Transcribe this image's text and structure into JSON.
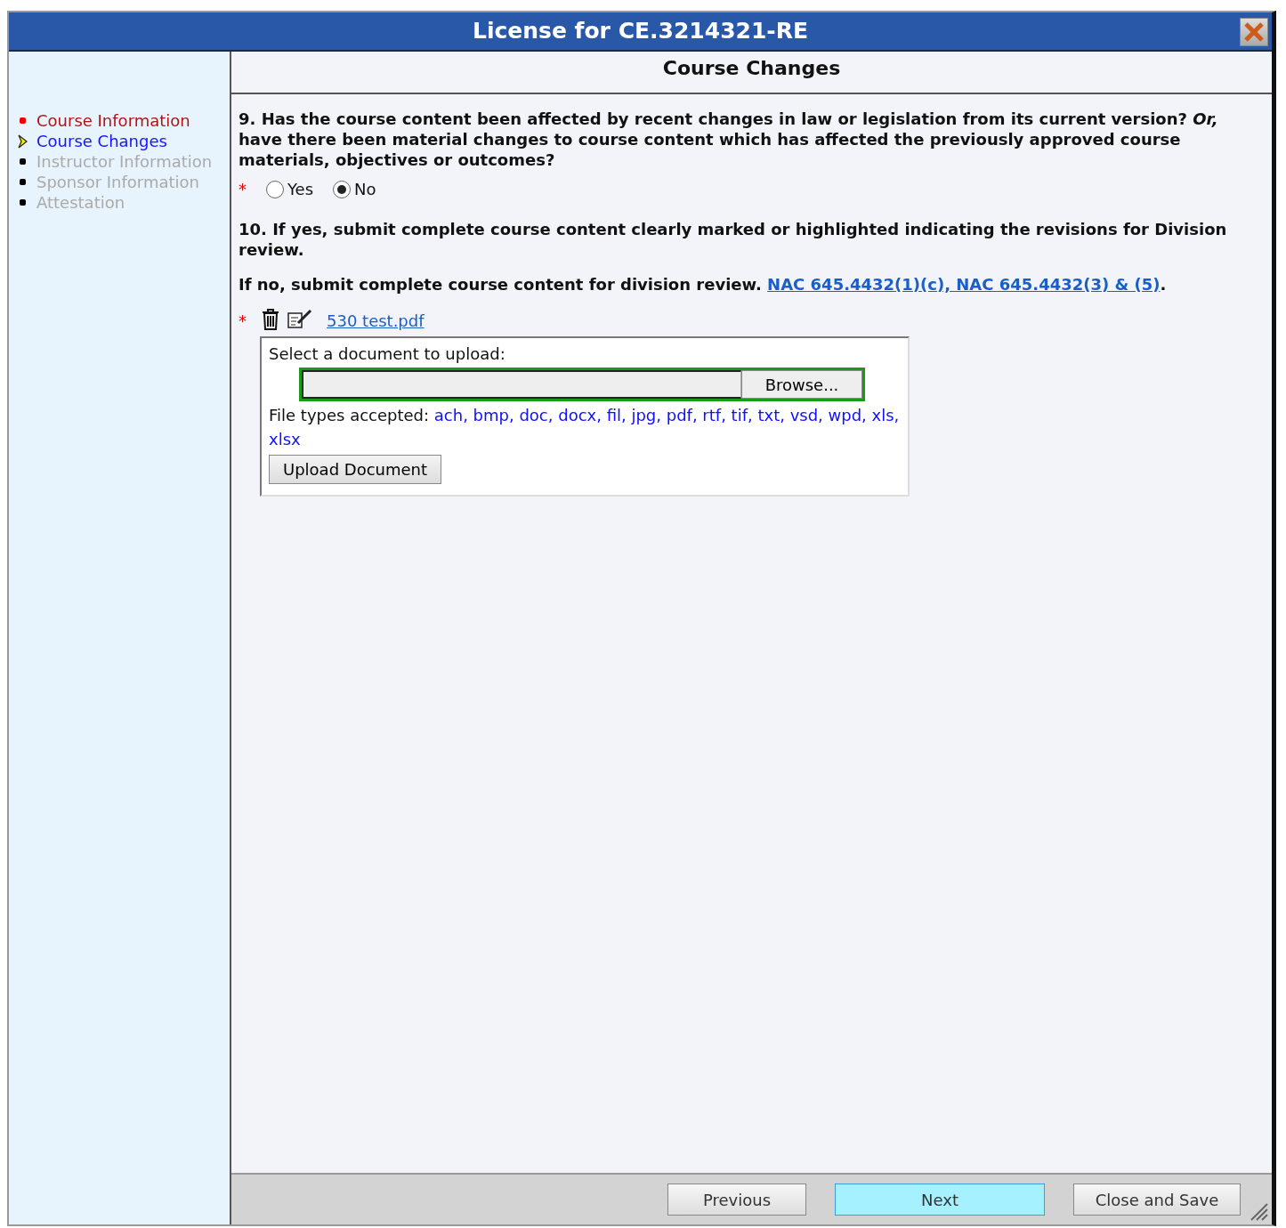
{
  "window": {
    "title": "License for CE.3214321-RE"
  },
  "sidebar": {
    "items": [
      {
        "label": "Course Information",
        "selected": false,
        "disabled": false
      },
      {
        "label": "Course Changes",
        "selected": true,
        "disabled": false
      },
      {
        "label": "Instructor Information",
        "selected": false,
        "disabled": true
      },
      {
        "label": "Sponsor Information",
        "selected": false,
        "disabled": true
      },
      {
        "label": "Attestation",
        "selected": false,
        "disabled": true
      }
    ]
  },
  "page": {
    "heading": "Course Changes",
    "question_9": {
      "text": "9. Has the course content been affected by recent changes in law or legislation from its current version? *Or,* have there been material changes to course content which has affected the previously approved course materials, objectives or outcomes?",
      "required_mark": "*",
      "options": [
        {
          "label": "Yes",
          "selected": false
        },
        {
          "label": "No",
          "selected": true
        }
      ]
    },
    "question_10": {
      "text": "10. If yes, submit complete course content clearly marked or highlighted indicating the revisions for Division review."
    },
    "instruction": {
      "text": "If no, submit complete course content for division review.",
      "link": "NAC 645.4432(1)(c), NAC 645.4432(3) & (5)",
      "after": "."
    },
    "attachment": {
      "required_mark": "*",
      "file_name": "530 test.pdf"
    },
    "upload": {
      "label": "Select a document to upload:",
      "browse_button": "Browse...",
      "types_label": "File types accepted:",
      "types": "ach, bmp, doc, docx, fil, jpg, pdf, rtf, tif, txt, vsd, wpd, xls, xlsx",
      "button": "Upload Document"
    }
  },
  "footer": {
    "buttons": [
      {
        "label": "Previous",
        "kind": "normal"
      },
      {
        "label": "Next",
        "kind": "highlight"
      },
      {
        "label": "Close and Save",
        "kind": "normal"
      }
    ]
  }
}
